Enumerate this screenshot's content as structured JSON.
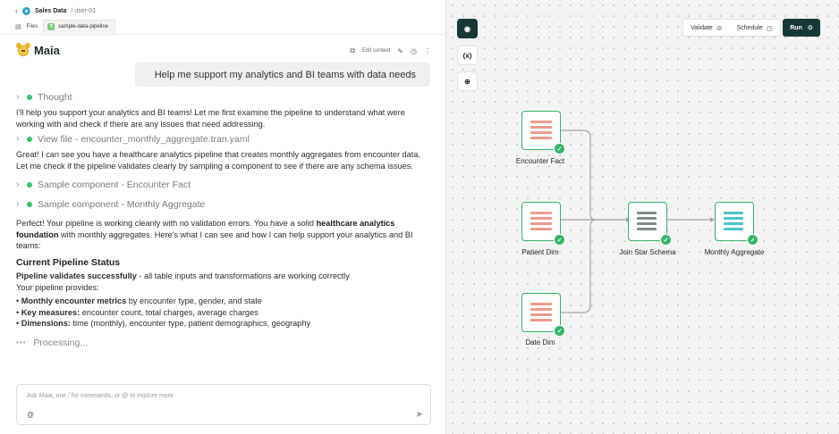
{
  "header": {
    "back_glyph": "‹",
    "app_name": "Sales Data",
    "user_path": "/ user-01",
    "files_label": "Files",
    "file_tab_label": "sample-data-pipeline",
    "file_tab_glyph": "T"
  },
  "assistant": {
    "name": "Maia",
    "tools": {
      "edit_context": "Edit context"
    }
  },
  "user_message": "Help me support my analytics and BI teams with data needs",
  "chat": {
    "thought_label": "Thought",
    "intro": "I'll help you support your analytics and BI teams! Let me first examine the pipeline to understand what were working with and check if there are any issues that need addressing.",
    "view_file_label": "View file - encounter_monthly_aggregate.tran.yaml",
    "after_view": "Great! I can see you have a healthcare analytics pipeline that creates monthly aggregates from encounter data. Let me check if the pipeline validates clearly by sampling a component to see if there are any schema issues.",
    "sample1_label": "Sample component - Encounter Fact",
    "sample2_label": "Sample component - Monthly Aggregate",
    "summary_pre": "Perfect! Your pipeline is working cleanly with no validation errors. You have a solid",
    "summary_bold": "healthcare analytics foundation",
    "summary_post": "with monthly aggregates. Here's what I can see and how I can help support your analytics and BI teams:",
    "status_heading": "Current Pipeline Status",
    "validates_bold": "Pipeline validates successfully",
    "validates_rest": "- all table inputs and transformations are working correctly",
    "provides": "Your pipeline provides:",
    "bullets": [
      {
        "bold": "Monthly encounter metrics",
        "rest": "by encounter type, gender, and state"
      },
      {
        "bold": "Key measures:",
        "rest": "encounter count, total charges, average charges"
      },
      {
        "bold": "Dimensions:",
        "rest": "time (monthly), encounter type, patient demographics, geography"
      }
    ],
    "processing_label": "Processing..."
  },
  "composer": {
    "placeholder": "Ask Maia, use / for commands, or @ to explore more",
    "at_symbol": "@"
  },
  "canvas": {
    "side_buttons": {
      "variables": "(x)",
      "add": "⊕"
    },
    "actions": {
      "validate": "Validate",
      "schedule": "Schedule",
      "run": "Run"
    },
    "nodes": {
      "encounter_fact": "Encounter Fact",
      "patient_dim": "Patient Dim",
      "date_dim": "Date Dim",
      "join_star": "Join Star Schema",
      "monthly_agg": "Monthly Aggregate"
    }
  },
  "colors": {
    "accent_dark": "#173836",
    "success_green": "#35b46a",
    "table_bar": "#ef9a8a",
    "join_bar": "#7f8b8a",
    "agg_bar": "#4fc3c7"
  }
}
